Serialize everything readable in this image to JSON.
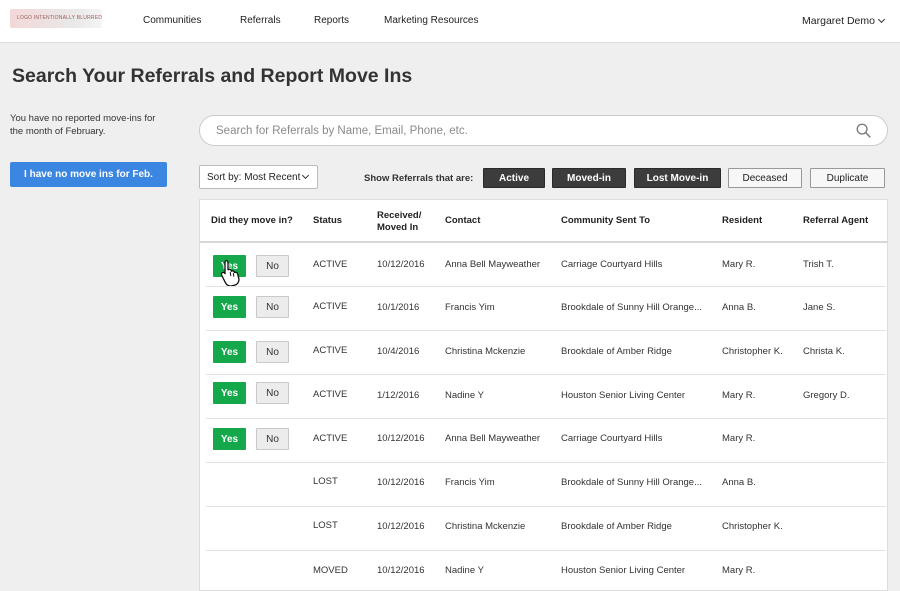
{
  "nav": {
    "logo_text": "LOGO INTENTIONALLY BLURRED",
    "links": [
      "Communities",
      "Referrals",
      "Reports",
      "Marketing Resources"
    ],
    "user": "Margaret Demo",
    "user_icon": "chevron-down-icon"
  },
  "page": {
    "title": "Search Your Referrals and Report Move Ins",
    "side_note": "You have no reported move-ins for the month of February.",
    "no_move_button": "I have no move ins for Feb."
  },
  "search": {
    "placeholder": "Search for Referrals by Name, Email, Phone, etc.",
    "value": "",
    "icon": "search-icon"
  },
  "sort": {
    "label": "Sort by: Most Recent"
  },
  "filters": {
    "label": "Show Referrals that are:",
    "options": [
      {
        "label": "Active",
        "selected": true
      },
      {
        "label": "Moved-in",
        "selected": true
      },
      {
        "label": "Lost Move-in",
        "selected": true
      },
      {
        "label": "Deceased",
        "selected": false
      },
      {
        "label": "Duplicate",
        "selected": false
      }
    ]
  },
  "table": {
    "headers": {
      "move_in": "Did they move in?",
      "status": "Status",
      "received": "Received/",
      "received2": "Moved In",
      "contact": "Contact",
      "community": "Community Sent To",
      "resident": "Resident",
      "agent": "Referral Agent"
    },
    "yes_label": "Yes",
    "no_label": "No",
    "rows": [
      {
        "status": "ACTIVE",
        "date": "10/12/2016",
        "contact": "Anna Bell Mayweather",
        "community": "Carriage Courtyard Hills",
        "resident": "Mary R.",
        "agent": "Trish T."
      },
      {
        "status": "ACTIVE",
        "date": "10/1/2016",
        "contact": "Francis Yim",
        "community": "Brookdale of Sunny Hill Orange...",
        "resident": "Anna B.",
        "agent": "Jane S."
      },
      {
        "status": "ACTIVE",
        "date": "10/4/2016",
        "contact": "Christina Mckenzie",
        "community": "Brookdale of Amber Ridge",
        "resident": "Christopher K.",
        "agent": "Christa K."
      },
      {
        "status": "ACTIVE",
        "date": "1/12/2016",
        "contact": "Nadine Y",
        "community": "Houston Senior Living Center",
        "resident": "Mary R.",
        "agent": "Gregory D."
      },
      {
        "status": "ACTIVE",
        "date": "10/12/2016",
        "contact": "Anna Bell Mayweather",
        "community": "Carriage Courtyard Hills",
        "resident": "Mary R.",
        "agent": ""
      },
      {
        "status": "LOST",
        "date": "10/12/2016",
        "contact": "Francis Yim",
        "community": "Brookdale of Sunny Hill Orange...",
        "resident": "Anna B.",
        "agent": ""
      },
      {
        "status": "LOST",
        "date": "10/12/2016",
        "contact": "Christina Mckenzie",
        "community": "Brookdale of Amber Ridge",
        "resident": "Christopher K.",
        "agent": ""
      },
      {
        "status": "MOVED",
        "date": "10/12/2016",
        "contact": "Nadine Y",
        "community": "Houston Senior Living Center",
        "resident": "Mary R.",
        "agent": ""
      }
    ]
  },
  "colors": {
    "yes": "#14a84a",
    "primary_button": "#3a86e0",
    "filter_on": "#3c3c3c"
  }
}
